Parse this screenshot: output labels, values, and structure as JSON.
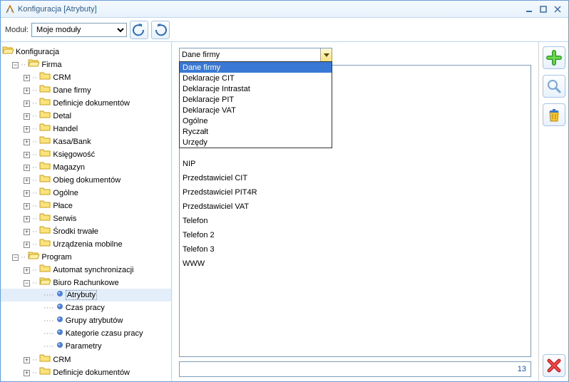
{
  "window": {
    "title": "Konfiguracja [Atrybuty]"
  },
  "toolbar": {
    "modul_label": "Moduł:",
    "modul_value": "Moje moduły"
  },
  "tree": {
    "root": "Konfiguracja",
    "firma": "Firma",
    "firma_children": [
      "CRM",
      "Dane firmy",
      "Definicje dokumentów",
      "Detal",
      "Handel",
      "Kasa/Bank",
      "Księgowość",
      "Magazyn",
      "Obieg dokumentów",
      "Ogólne",
      "Płace",
      "Serwis",
      "Środki trwałe",
      "Urządzenia mobilne"
    ],
    "program": "Program",
    "program_children": [
      "Automat synchronizacji"
    ],
    "biuro": "Biuro Rachunkowe",
    "biuro_children": [
      "Atrybuty",
      "Czas pracy",
      "Grupy atrybutów",
      "Kategorie czasu pracy",
      "Parametry"
    ],
    "program_after": [
      "CRM",
      "Definicje dokumentów"
    ]
  },
  "combo": {
    "value": "Dane firmy",
    "options": [
      "Dane firmy",
      "Deklaracje CIT",
      "Deklaracje Intrastat",
      "Deklaracje PIT",
      "Deklaracje VAT",
      "Ogólne",
      "Ryczałt",
      "Urzędy"
    ]
  },
  "list": {
    "items": [
      "NIP",
      "Przedstawiciel CIT",
      "Przedstawiciel PIT4R",
      "Przedstawiciel VAT",
      "Telefon",
      "Telefon 2",
      "Telefon 3",
      "WWW"
    ]
  },
  "status": {
    "count": "13"
  }
}
